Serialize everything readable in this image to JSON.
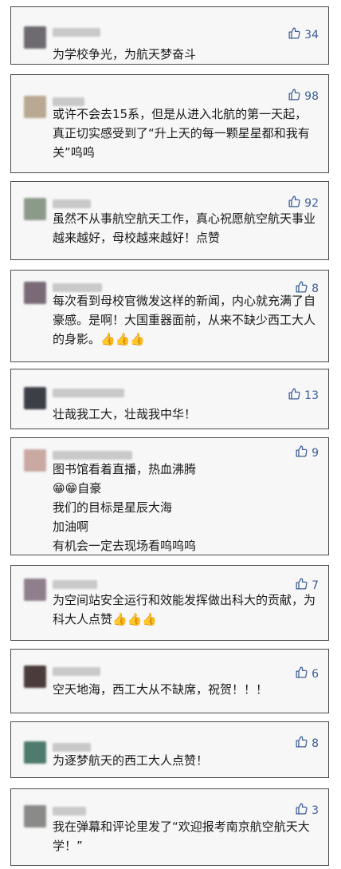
{
  "comments": [
    {
      "likes": "34",
      "text": "为学校争光，为航天梦奋斗",
      "avatar_color": "#6e6a70"
    },
    {
      "likes": "98",
      "text": "或许不会去15系，但是从进入北航的第一天起，真正切实感受到了“升上天的每一颗星星都和我有关”呜呜",
      "avatar_color": "#b9a892"
    },
    {
      "likes": "92",
      "text": "虽然不从事航空航天工作，真心祝愿航空航天事业越来越好，母校越来越好！点赞",
      "avatar_color": "#8c9a8a"
    },
    {
      "likes": "8",
      "text": "每次看到母校官微发这样的新闻，内心就充满了自豪感。是啊！大国重器面前，从来不缺少西工大人的身影。👍👍👍",
      "avatar_color": "#7a6a78"
    },
    {
      "likes": "13",
      "text": "壮哉我工大，壮哉我中华！",
      "avatar_color": "#3c4046"
    },
    {
      "likes": "9",
      "text": "图书馆看着直播，热血沸腾\n😁😁自豪\n我们的目标是星辰大海\n加油啊\n有机会一定去现场看呜呜呜",
      "avatar_color": "#c9a9a2"
    },
    {
      "likes": "7",
      "text": "为空间站安全运行和效能发挥做出科大的贡献，为科大人点赞👍👍👍",
      "avatar_color": "#8f7f8c"
    },
    {
      "likes": "6",
      "text": "空天地海，西工大从不缺席，祝贺！！！",
      "avatar_color": "#4a3c3a"
    },
    {
      "likes": "8",
      "text": "为逐梦航天的西工大人点赞！",
      "avatar_color": "#4f7a6e"
    },
    {
      "likes": "3",
      "text": "我在弹幕和评论里发了“欢迎报考南京航空航天大学！”",
      "avatar_color": "#8a8a88"
    }
  ]
}
